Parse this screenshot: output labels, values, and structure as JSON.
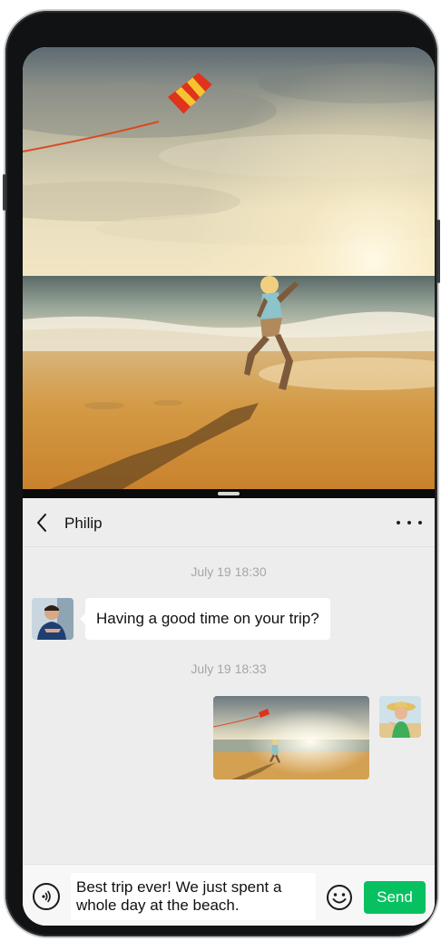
{
  "chat": {
    "contact_name": "Philip",
    "messages": [
      {
        "timestamp": "July 19 18:30",
        "sender": "contact",
        "type": "text",
        "text": "Having a good time on your trip?"
      },
      {
        "timestamp": "July 19 18:33",
        "sender": "self",
        "type": "image",
        "image": "beach-kite-photo"
      }
    ],
    "input_value": "Best trip ever! We just spent a whole day at the beach.",
    "send_label": "Send"
  },
  "icons": {
    "back": "chevron-left-icon",
    "more": "more-dots-icon",
    "voice": "voice-icon",
    "emoji": "emoji-icon"
  },
  "colors": {
    "accent": "#07c160",
    "chat_background": "#ededed",
    "timestamp": "#a6a6a6"
  }
}
